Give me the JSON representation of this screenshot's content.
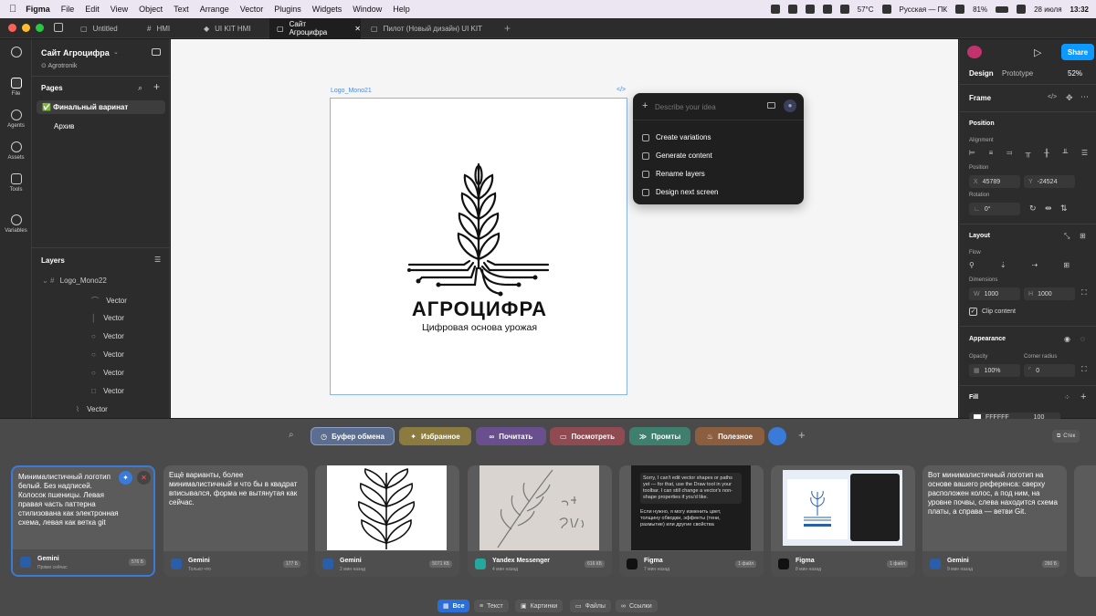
{
  "menubar": {
    "app": "Figma",
    "items": [
      "File",
      "Edit",
      "View",
      "Object",
      "Text",
      "Arrange",
      "Vector",
      "Plugins",
      "Widgets",
      "Window",
      "Help"
    ],
    "temp": "57°C",
    "keyboard": "Русская — ПК",
    "battery": "81%",
    "date": "28 июля",
    "time": "13:32"
  },
  "tabs": [
    "Untitled",
    "HMI",
    "UI KIT HMI",
    "Сайт Агроцифра",
    "Пилот (Новый дизайн) UI KIT"
  ],
  "rail": [
    "File",
    "Agents",
    "Assets",
    "Tools",
    "Variables"
  ],
  "left": {
    "project": "Сайт Агроцифра",
    "team": "Agrotronik",
    "pages_title": "Pages",
    "pages": [
      "✅ Финальный варинат",
      "Архив"
    ],
    "layers_title": "Layers",
    "root_layer": "Logo_Mono22",
    "layers": [
      "Vector",
      "Vector",
      "Vector",
      "Vector",
      "Vector",
      "Vector",
      "Vector"
    ]
  },
  "canvas": {
    "frame_label": "Logo_Mono21",
    "code_label": "</>",
    "logo_title": "АГРОЦИФРА",
    "logo_sub": "Цифровая основа урожая"
  },
  "ai": {
    "placeholder": "Describe your idea",
    "items": [
      "Create variations",
      "Generate content",
      "Rename layers",
      "Design next screen"
    ]
  },
  "right": {
    "share": "Share",
    "tab_design": "Design",
    "tab_prototype": "Prototype",
    "zoom": "52%",
    "frame": "Frame",
    "position": "Position",
    "alignment": "Alignment",
    "pos_label": "Position",
    "x": "45789",
    "y": "-24524",
    "rotation_label": "Rotation",
    "rotation": "0°",
    "layout": "Layout",
    "flow": "Flow",
    "dimensions": "Dimensions",
    "w": "1000",
    "h": "1000",
    "clip": "Clip content",
    "appearance": "Appearance",
    "opacity_label": "Opacity",
    "corner_label": "Corner radius",
    "opacity": "100%",
    "corner": "0",
    "fill": "Fill",
    "fill_hex": "FFFFFF",
    "fill_pct": "100"
  },
  "clipboard": {
    "chips": [
      {
        "label": "Буфер обмена",
        "color": "#5b6e8f",
        "icon": "clock-icon"
      },
      {
        "label": "Избранное",
        "color": "#8c7b3f",
        "icon": "pin-icon"
      },
      {
        "label": "Почитать",
        "color": "#6a4f8f",
        "icon": "glasses-icon"
      },
      {
        "label": "Посмотреть",
        "color": "#8f4a52",
        "icon": "screen-icon"
      },
      {
        "label": "Промты",
        "color": "#3f7f6d",
        "icon": "code-icon"
      },
      {
        "label": "Полезное",
        "color": "#8a5e3f",
        "icon": "flame-icon"
      }
    ],
    "stack": "Стек",
    "cards": [
      {
        "text": "Минималистичный логотип белый. Без надписей. Колосок пшеницы. Левая правая часть паттерна стилизована как электронная схема, левая как ветка git",
        "app": "Gemini",
        "sub": "Прямо сейчас",
        "size": "576 Б",
        "icon": "#2a5ea8",
        "kind": "text"
      },
      {
        "text": "Ещё варианты, более минималистичный и что бы в квадрат вписывался, форма не вытянутая как сейчас.",
        "app": "Gemini",
        "sub": "Только что",
        "size": "177 Б",
        "icon": "#2a5ea8",
        "kind": "text"
      },
      {
        "text": "",
        "app": "Gemini",
        "sub": "2 мин назад",
        "size": "5071 КБ",
        "icon": "#2a5ea8",
        "kind": "img-wheat"
      },
      {
        "text": "",
        "app": "Yandex Messenger",
        "sub": "4 мин назад",
        "size": "616 КБ",
        "icon": "#24a89b",
        "kind": "img-sketch"
      },
      {
        "text": "Sorry, I can't edit vector shapes or paths yet — for that, use the Draw tool in your toolbar. I can still change a vector's non-shape properties if you'd like.",
        "text2": "Если нужно, я могу изменить цвет, толщину обводки, эффекты (тени, размытие) или другие свойства",
        "app": "Figma",
        "sub": "7 мин назад",
        "size": "1 файл",
        "icon": "#111",
        "kind": "img-dark"
      },
      {
        "text": "",
        "app": "Figma",
        "sub": "8 мин назад",
        "size": "1 файл",
        "icon": "#111",
        "kind": "img-figma"
      },
      {
        "text": "Вот минималистичный логотип на основе вашего референса: сверху расположен колос, а под ним, на уровне почвы, слева находится схема платы, а справа — ветви Git.",
        "app": "Gemini",
        "sub": "9 мин назад",
        "size": "260 Б",
        "icon": "#2a5ea8",
        "kind": "text"
      }
    ],
    "filters": [
      "Все",
      "Текст",
      "Картинки",
      "Файлы",
      "Ссылки"
    ]
  }
}
